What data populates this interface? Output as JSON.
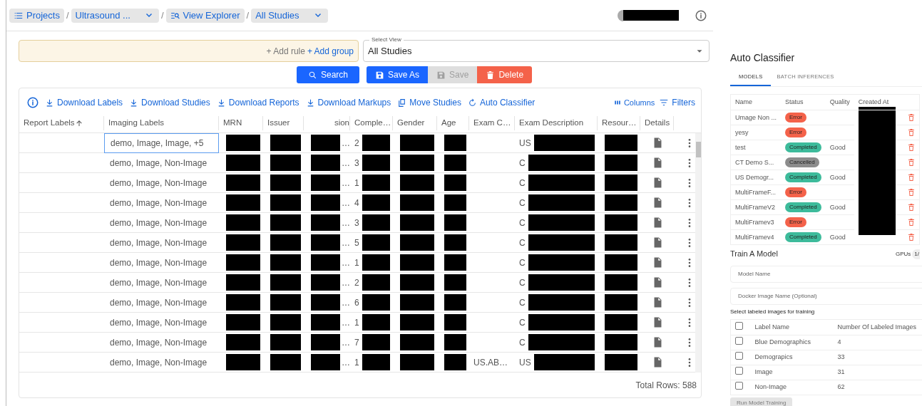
{
  "breadcrumbs": [
    {
      "kind": "list",
      "label": "Projects",
      "dropdown": false
    },
    {
      "kind": "plain",
      "separator": "/",
      "label": "Ultrasound ...",
      "dropdown": true
    },
    {
      "kind": "explorer",
      "separator": "/",
      "label": "View Explorer",
      "dropdown": false
    },
    {
      "kind": "plain",
      "separator": "/",
      "label": "All Studies",
      "dropdown": true
    }
  ],
  "user": {
    "redacted": true
  },
  "query": {
    "add_rule": "+ Add rule",
    "add_group": "+ Add group"
  },
  "select_view": {
    "label": "Select View",
    "value": "All Studies"
  },
  "buttons": [
    {
      "kind": "search",
      "label": "Search",
      "disabled": false
    },
    {
      "kind": "save_as",
      "label": "Save As",
      "disabled": false
    },
    {
      "kind": "save",
      "label": "Save",
      "disabled": true
    },
    {
      "kind": "delete",
      "label": "Delete",
      "disabled": false
    }
  ],
  "toolbar": [
    {
      "kind": "download",
      "label": "Download Labels"
    },
    {
      "kind": "download",
      "label": "Download Studies"
    },
    {
      "kind": "download",
      "label": "Download Reports"
    },
    {
      "kind": "download",
      "label": "Download Markups"
    },
    {
      "kind": "move",
      "label": "Move Studies"
    },
    {
      "kind": "classifier",
      "label": "Auto Classifier"
    }
  ],
  "toolbar_right": [
    {
      "kind": "columns",
      "label": "Columns"
    },
    {
      "kind": "filters",
      "label": "Filters"
    }
  ],
  "table": {
    "columns": [
      {
        "label": "Report Labels",
        "sorted": true
      },
      {
        "label": "Imaging Labels",
        "sorted": false
      },
      {
        "label": "MRN",
        "sorted": false,
        "redacted": true
      },
      {
        "label": "Issuer",
        "sorted": false,
        "redacted": true
      },
      {
        "label": "sion",
        "sorted": false,
        "redacted": true
      },
      {
        "label": "Comple…",
        "sorted": false,
        "redacted": true
      },
      {
        "label": "Gender",
        "sorted": false,
        "redacted": true
      },
      {
        "label": "Age",
        "sorted": false,
        "redacted": true
      },
      {
        "label": "Exam C…",
        "sorted": false
      },
      {
        "label": "Exam Description",
        "sorted": false,
        "redacted": true
      },
      {
        "label": "Resour…",
        "sorted": false,
        "redacted": true
      },
      {
        "label": "Details",
        "sorted": false
      }
    ],
    "rows": [
      {
        "editing": true,
        "cells": [
          "",
          "demo, Image, Image, +5",
          "",
          "",
          "…",
          "2",
          "",
          "",
          "",
          "US",
          ""
        ]
      },
      {
        "editing": false,
        "cells": [
          "",
          "demo, Image, Non-Image",
          "",
          "",
          "…",
          "3",
          "",
          "",
          "",
          "C",
          ""
        ]
      },
      {
        "editing": false,
        "cells": [
          "",
          "demo, Image, Non-Image",
          "",
          "",
          "…",
          "1",
          "",
          "",
          "",
          "C",
          ""
        ]
      },
      {
        "editing": false,
        "cells": [
          "",
          "demo, Image, Non-Image",
          "",
          "",
          "…",
          "4",
          "",
          "",
          "",
          "C",
          ""
        ]
      },
      {
        "editing": false,
        "cells": [
          "",
          "demo, Image, Non-Image",
          "",
          "",
          "…",
          "3",
          "",
          "",
          "",
          "C",
          ""
        ]
      },
      {
        "editing": false,
        "cells": [
          "",
          "demo, Image, Non-Image",
          "",
          "",
          "…",
          "5",
          "",
          "",
          "",
          "C",
          ""
        ]
      },
      {
        "editing": false,
        "cells": [
          "",
          "demo, Image, Non-Image",
          "",
          "",
          "…",
          "1",
          "",
          "",
          "",
          "C",
          ""
        ]
      },
      {
        "editing": false,
        "cells": [
          "",
          "demo, Image, Non-Image",
          "",
          "",
          "…",
          "2",
          "",
          "",
          "",
          "C",
          ""
        ]
      },
      {
        "editing": false,
        "cells": [
          "",
          "demo, Image, Non-Image",
          "",
          "",
          "…",
          "6",
          "",
          "",
          "",
          "C",
          ""
        ]
      },
      {
        "editing": false,
        "cells": [
          "",
          "demo, Image, Non-Image",
          "",
          "",
          "…",
          "1",
          "",
          "",
          "",
          "C",
          ""
        ]
      },
      {
        "editing": false,
        "cells": [
          "",
          "demo, Image, Non-Image",
          "",
          "",
          "…",
          "7",
          "",
          "",
          "",
          "C",
          ""
        ]
      },
      {
        "editing": false,
        "cells": [
          "",
          "demo, Image, Non-Image",
          "",
          "",
          "…",
          "1",
          "",
          "",
          "US.AB…",
          "US",
          ""
        ]
      }
    ],
    "total": "Total Rows: 588"
  },
  "classifier": {
    "title": "Auto Classifier",
    "tabs": [
      {
        "label": "MODELS",
        "selected": true
      },
      {
        "label": "BATCH INFERENCES",
        "selected": false
      }
    ],
    "columns": [
      "Name",
      "Status",
      "Quality",
      "Created At"
    ],
    "models": [
      {
        "name": "Umage Non ...",
        "status": "Error",
        "color": "#f4624a"
      },
      {
        "name": "yesy",
        "status": "Error",
        "color": "#f4624a"
      },
      {
        "name": "test",
        "status": "Completed",
        "color": "#3dbb9b",
        "quality": "Good"
      },
      {
        "name": "CT Demo S...",
        "status": "Cancelled",
        "color": "#8c8c8c"
      },
      {
        "name": "US Demogr...",
        "status": "Completed",
        "color": "#3dbb9b",
        "quality": "Good"
      },
      {
        "name": "MultiFrameF...",
        "status": "Error",
        "color": "#f4624a"
      },
      {
        "name": "MultiFrameV2",
        "status": "Completed",
        "color": "#3dbb9b",
        "quality": "Good"
      },
      {
        "name": "MultiFramev3",
        "status": "Error",
        "color": "#f4624a"
      },
      {
        "name": "MultiFramev4",
        "status": "Completed",
        "color": "#3dbb9b",
        "quality": "Good"
      }
    ],
    "train_title": "Train A Model",
    "gpus_label": "GPUs",
    "gpus_value": "1/",
    "fields": [
      {
        "placeholder": "Model Name"
      },
      {
        "placeholder": "Docker Image Name (Optional)"
      }
    ],
    "select_text": "Select labeled images for training",
    "label_columns": [
      "Label Name",
      "Number Of Labeled Images"
    ],
    "select_all_checked": false,
    "labels": [
      {
        "name": "Blue Demographics",
        "count": "4",
        "checked": false
      },
      {
        "name": "Demograpics",
        "count": "33",
        "checked": false
      },
      {
        "name": "Image",
        "count": "31",
        "checked": false
      },
      {
        "name": "Non-Image",
        "count": "62",
        "checked": false
      }
    ],
    "run_button": {
      "label": "Run Model Training",
      "disabled": true
    }
  }
}
